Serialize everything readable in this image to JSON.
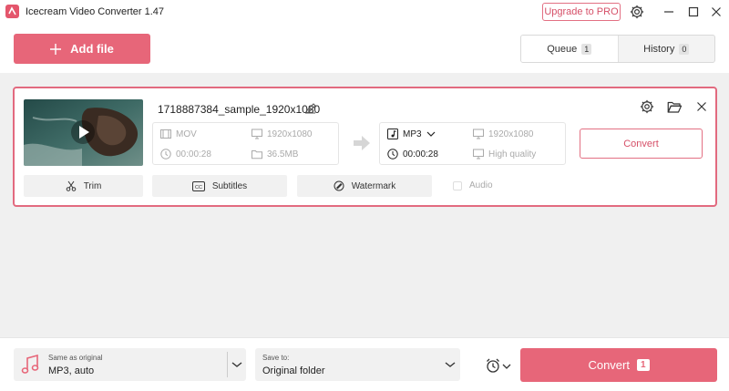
{
  "window": {
    "title": "Icecream Video Converter 1.47",
    "upgrade_label": "Upgrade to PRO",
    "icons": [
      "app-logo",
      "gear-icon",
      "minimize-icon",
      "maximize-icon",
      "close-icon"
    ]
  },
  "header": {
    "add_file_label": "Add file",
    "tabs": [
      {
        "label": "Queue",
        "count": "1",
        "active": true
      },
      {
        "label": "History",
        "count": "0",
        "active": false
      }
    ]
  },
  "file": {
    "name": "1718887384_sample_1920x1080",
    "source": {
      "format": "MOV",
      "resolution": "1920x1080",
      "duration": "00:00:28",
      "size": "36.5MB"
    },
    "output": {
      "format": "MP3",
      "resolution": "1920x1080",
      "duration": "00:00:28",
      "quality": "High quality"
    },
    "convert_label": "Convert",
    "tools": {
      "trim": "Trim",
      "subtitles": "Subtitles",
      "watermark": "Watermark",
      "audio": "Audio"
    }
  },
  "footer": {
    "profile": {
      "label": "Same as original",
      "value": "MP3, auto"
    },
    "save": {
      "label": "Save to:",
      "value": "Original folder"
    },
    "convert_label": "Convert",
    "convert_count": "1"
  },
  "colors": {
    "accent": "#e76679",
    "accent_text": "#d65068",
    "background": "#f0f0f0"
  }
}
